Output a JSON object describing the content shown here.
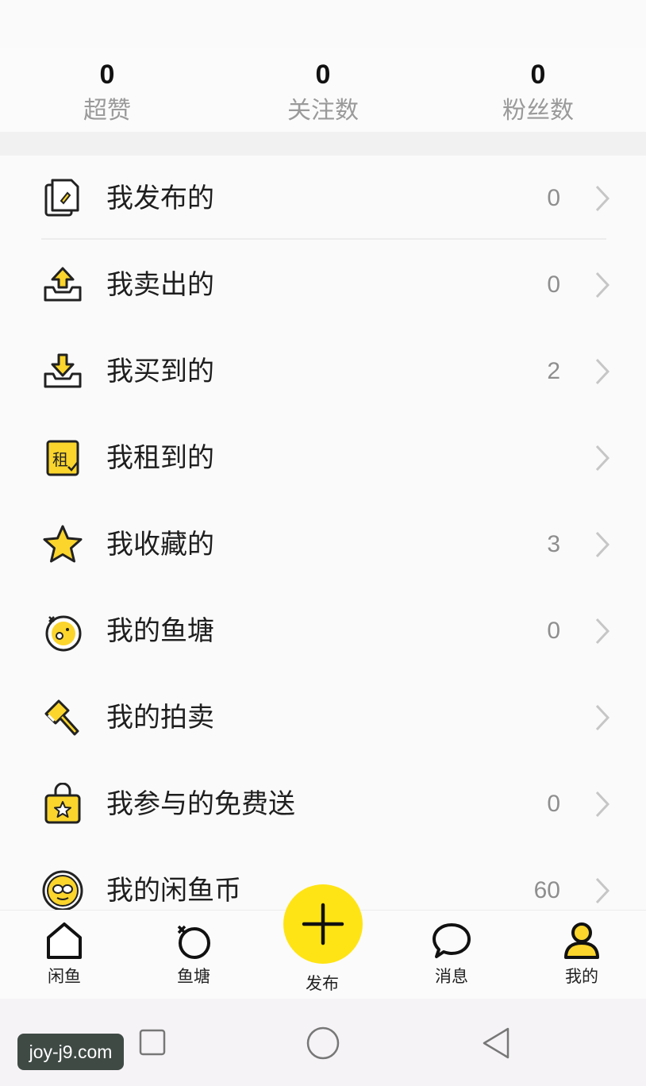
{
  "stats": [
    {
      "value": "0",
      "label": "超赞"
    },
    {
      "value": "0",
      "label": "关注数"
    },
    {
      "value": "0",
      "label": "粉丝数"
    }
  ],
  "menu": [
    {
      "label": "我发布的",
      "count": "0",
      "icon": "published-icon"
    },
    {
      "label": "我卖出的",
      "count": "0",
      "icon": "sold-icon"
    },
    {
      "label": "我买到的",
      "count": "2",
      "icon": "bought-icon"
    },
    {
      "label": "我租到的",
      "count": "",
      "icon": "rented-icon",
      "icon_text": "租"
    },
    {
      "label": "我收藏的",
      "count": "3",
      "icon": "star-icon"
    },
    {
      "label": "我的鱼塘",
      "count": "0",
      "icon": "fishpond-icon"
    },
    {
      "label": "我的拍卖",
      "count": "",
      "icon": "auction-hammer-icon"
    },
    {
      "label": "我参与的免费送",
      "count": "0",
      "icon": "free-gift-bag-icon"
    },
    {
      "label": "我的闲鱼币",
      "count": "60",
      "icon": "xianyu-coin-icon"
    }
  ],
  "tabs": {
    "home": "闲鱼",
    "pond": "鱼塘",
    "publish": "发布",
    "messages": "消息",
    "mine": "我的"
  },
  "watermark": "joy-j9.com",
  "colors": {
    "accent_yellow": "#ffe415",
    "icon_yellow": "#fbd52c",
    "text_dark": "#1e1e1e",
    "text_gray": "#8e8e8e"
  }
}
